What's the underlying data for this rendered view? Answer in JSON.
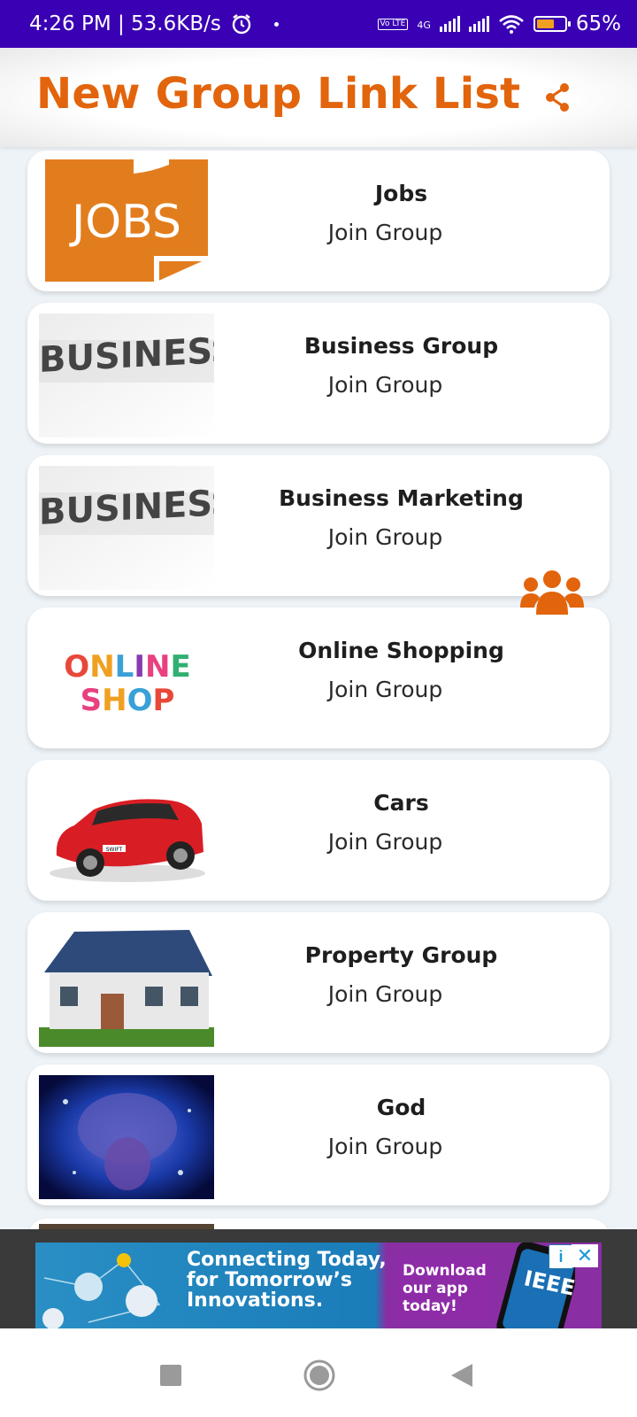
{
  "status_bar": {
    "time_speed": "4:26 PM | 53.6KB/s",
    "network": "4G",
    "volte": "Vo LTE",
    "battery": "65%",
    "battery_level": 0.65
  },
  "app_bar": {
    "title": "New Group Link List",
    "share_icon": "share-icon"
  },
  "groups": [
    {
      "title": "Jobs",
      "action": "Join Group",
      "thumb_text": "JOBS"
    },
    {
      "title": "Business Group",
      "action": "Join Group",
      "thumb_text": "BUSINESS"
    },
    {
      "title": "Business Marketing",
      "action": "Join Group",
      "thumb_text": "BUSINESS"
    },
    {
      "title": "Online Shopping",
      "action": "Join Group",
      "thumb_text": "ONLINE SHOP"
    },
    {
      "title": "Cars",
      "action": "Join Group",
      "thumb_text": "SWIFT"
    },
    {
      "title": "Property Group",
      "action": "Join Group"
    },
    {
      "title": "God",
      "action": "Join Group"
    }
  ],
  "fab": {
    "icon": "group-icon"
  },
  "ad": {
    "headline": "Connecting Today, for Tomorrow’s Innovations.",
    "cta": "Download our app today!",
    "brand": "IEEE",
    "info": "i",
    "close": "✕"
  },
  "colors": {
    "status_bar": "#3a00b4",
    "accent": "#e2640c",
    "card": "#ffffff",
    "background": "#eef3f7"
  }
}
